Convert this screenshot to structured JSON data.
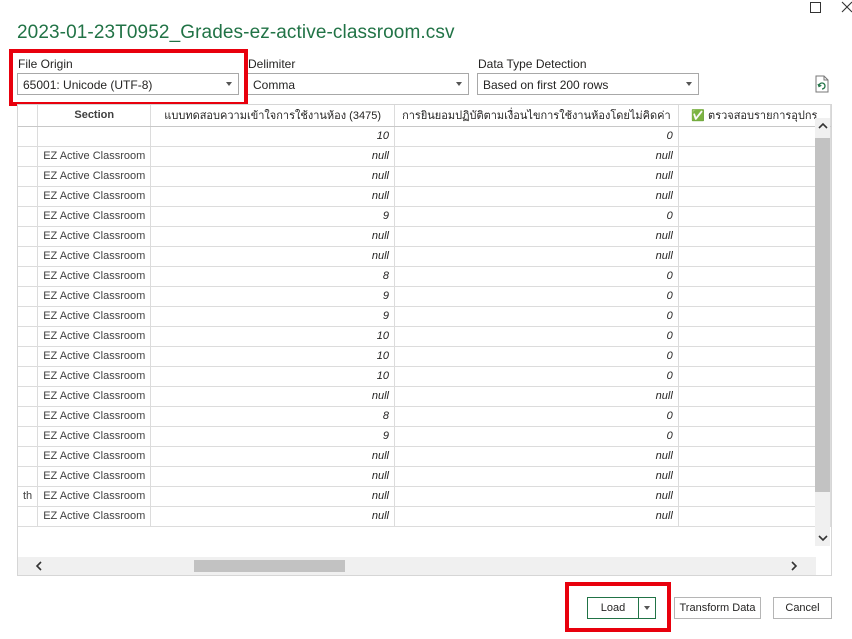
{
  "dialog": {
    "title": "2023-01-23T0952_Grades-ez-active-classroom.csv",
    "window_controls": {
      "maximize_icon": "maximize-icon",
      "close_icon": "close-icon"
    }
  },
  "options": {
    "file_origin": {
      "label": "File Origin",
      "value": "65001: Unicode (UTF-8)"
    },
    "delimiter": {
      "label": "Delimiter",
      "value": "Comma"
    },
    "data_type_detection": {
      "label": "Data Type Detection",
      "value": "Based on first 200 rows"
    },
    "refresh_icon": "refresh-icon"
  },
  "table": {
    "headers": [
      "",
      "Section",
      "แบบทดสอบความเข้าใจการใช้งานห้อง (3475)",
      "การยินยอมปฏิบัติตามเงื่อนไขการใช้งานห้องโดยไม่คิดค่า",
      "✅ ตรวจสอบรายการอุปกร"
    ],
    "rows": [
      [
        "",
        "",
        "10",
        "0",
        ""
      ],
      [
        "",
        "EZ Active Classroom",
        "null",
        "null",
        ""
      ],
      [
        "",
        "EZ Active Classroom",
        "null",
        "null",
        ""
      ],
      [
        "",
        "EZ Active Classroom",
        "null",
        "null",
        ""
      ],
      [
        "",
        "EZ Active Classroom",
        "9",
        "0",
        ""
      ],
      [
        "",
        "EZ Active Classroom",
        "null",
        "null",
        ""
      ],
      [
        "",
        "EZ Active Classroom",
        "null",
        "null",
        ""
      ],
      [
        "",
        "EZ Active Classroom",
        "8",
        "0",
        ""
      ],
      [
        "",
        "EZ Active Classroom",
        "9",
        "0",
        ""
      ],
      [
        "",
        "EZ Active Classroom",
        "9",
        "0",
        ""
      ],
      [
        "",
        "EZ Active Classroom",
        "10",
        "0",
        ""
      ],
      [
        "",
        "EZ Active Classroom",
        "10",
        "0",
        ""
      ],
      [
        "",
        "EZ Active Classroom",
        "10",
        "0",
        ""
      ],
      [
        "",
        "EZ Active Classroom",
        "null",
        "null",
        ""
      ],
      [
        "",
        "EZ Active Classroom",
        "8",
        "0",
        ""
      ],
      [
        "",
        "EZ Active Classroom",
        "9",
        "0",
        ""
      ],
      [
        "",
        "EZ Active Classroom",
        "null",
        "null",
        ""
      ],
      [
        "",
        "EZ Active Classroom",
        "null",
        "null",
        ""
      ],
      [
        "th",
        "EZ Active Classroom",
        "null",
        "null",
        ""
      ],
      [
        "",
        "EZ Active Classroom",
        "null",
        "null",
        ""
      ]
    ]
  },
  "footer": {
    "load_label": "Load",
    "transform_label": "Transform Data",
    "cancel_label": "Cancel"
  },
  "colors": {
    "accent": "#217346",
    "highlight": "#e8000d"
  }
}
